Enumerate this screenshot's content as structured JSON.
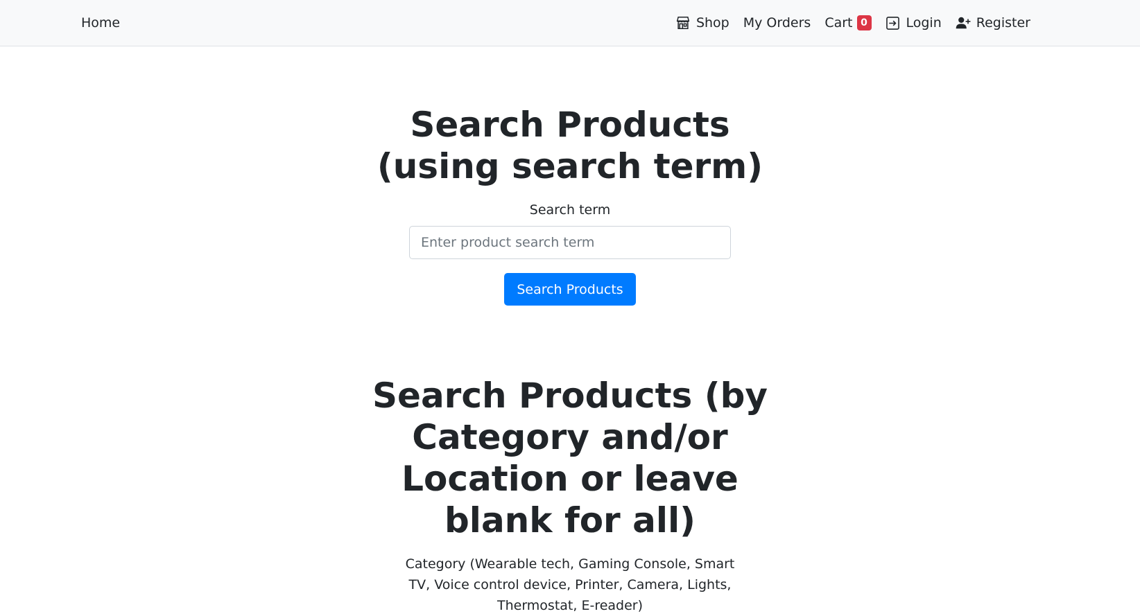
{
  "navbar": {
    "home_label": "Home",
    "shop_label": "Shop",
    "orders_label": "My Orders",
    "cart_label": "Cart",
    "cart_count": "0",
    "login_label": "Login",
    "register_label": "Register"
  },
  "term_search": {
    "title_line1": "Search Products",
    "title_line2": "(using search term)",
    "field_label": "Search term",
    "placeholder": "Enter product search term",
    "value": "",
    "button_label": "Search Products"
  },
  "category_search": {
    "title_line1": "Search Products (by",
    "title_line2": "Category and/or",
    "title_line3": "Location or leave",
    "title_line4": "blank for all)",
    "category_label_line1": "Category (Wearable tech, Gaming Console, Smart",
    "category_label_line2": "TV, Voice control device, Printer, Camera, Lights,",
    "category_label_line3": "Thermostat, E-reader)"
  },
  "colors": {
    "primary": "#007bff",
    "badge": "#dc3545",
    "navbar_bg": "#f8f9fa",
    "text": "#212529"
  },
  "icons": {
    "shop": "shop-icon",
    "login": "login-icon",
    "register": "person-plus-icon"
  }
}
